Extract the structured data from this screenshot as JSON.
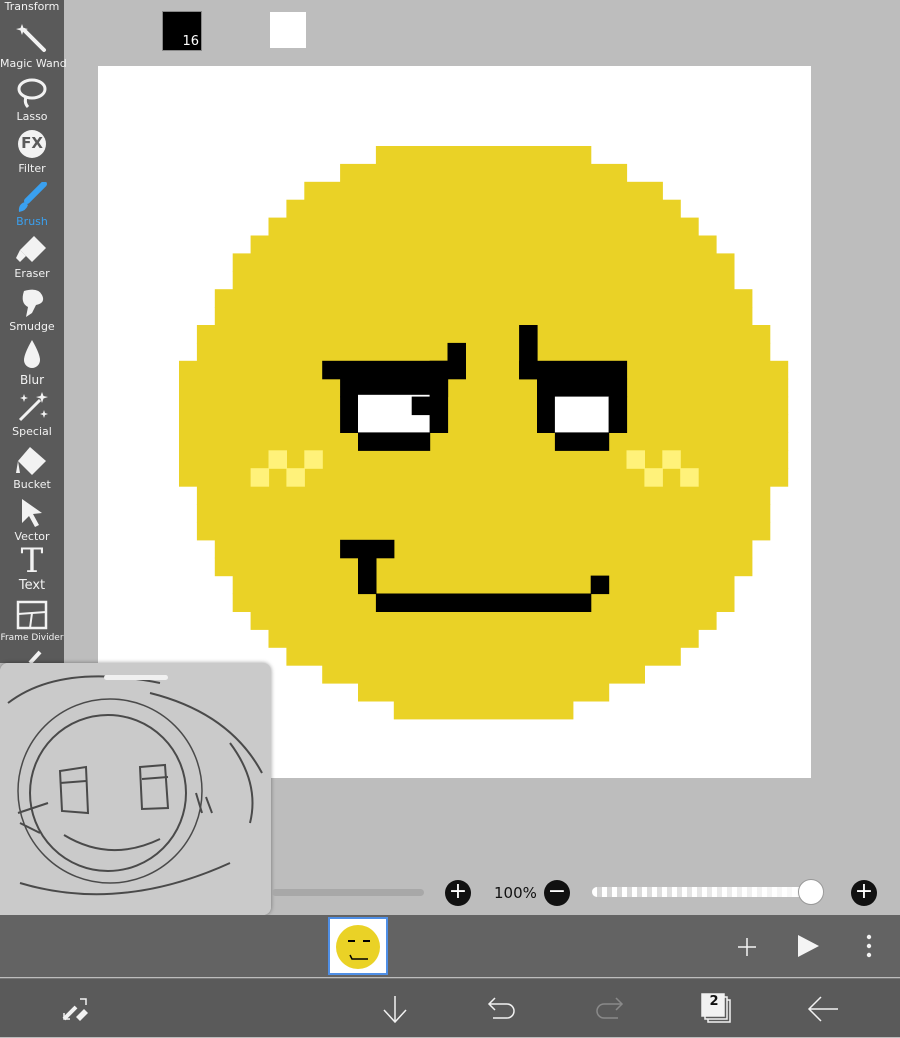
{
  "toolbar": {
    "tools": [
      {
        "label": "Transform"
      },
      {
        "label": "Magic Wand"
      },
      {
        "label": "Lasso"
      },
      {
        "label": "Filter"
      },
      {
        "label": "Brush"
      },
      {
        "label": "Eraser"
      },
      {
        "label": "Smudge"
      },
      {
        "label": "Blur"
      },
      {
        "label": "Special"
      },
      {
        "label": "Bucket"
      },
      {
        "label": "Vector"
      },
      {
        "label": "Text"
      },
      {
        "label": "Frame Divider"
      }
    ],
    "active_tool": "Brush",
    "filter_icon_text": "FX",
    "text_icon_text": "T"
  },
  "canvas": {
    "background": "#ffffff",
    "face_color": "#ead226",
    "blush_color": "#fff27a",
    "outline_color": "#000000",
    "eye_white": "#ffffff"
  },
  "layer_controls": {
    "opacity_value": "100%",
    "opacity_level": 1.0
  },
  "frames": {
    "count": 1,
    "selected": 1
  },
  "bottom_bar": {
    "brush_size": "16",
    "primary_color": "#000000",
    "secondary_color": "#ffffff",
    "layer_count": "2"
  },
  "colors": {
    "toolbar_bg": "#5a5a5a",
    "workspace_bg": "#bdbdbd",
    "accent": "#3aa0ef",
    "frame_border": "#4f8fe6"
  }
}
